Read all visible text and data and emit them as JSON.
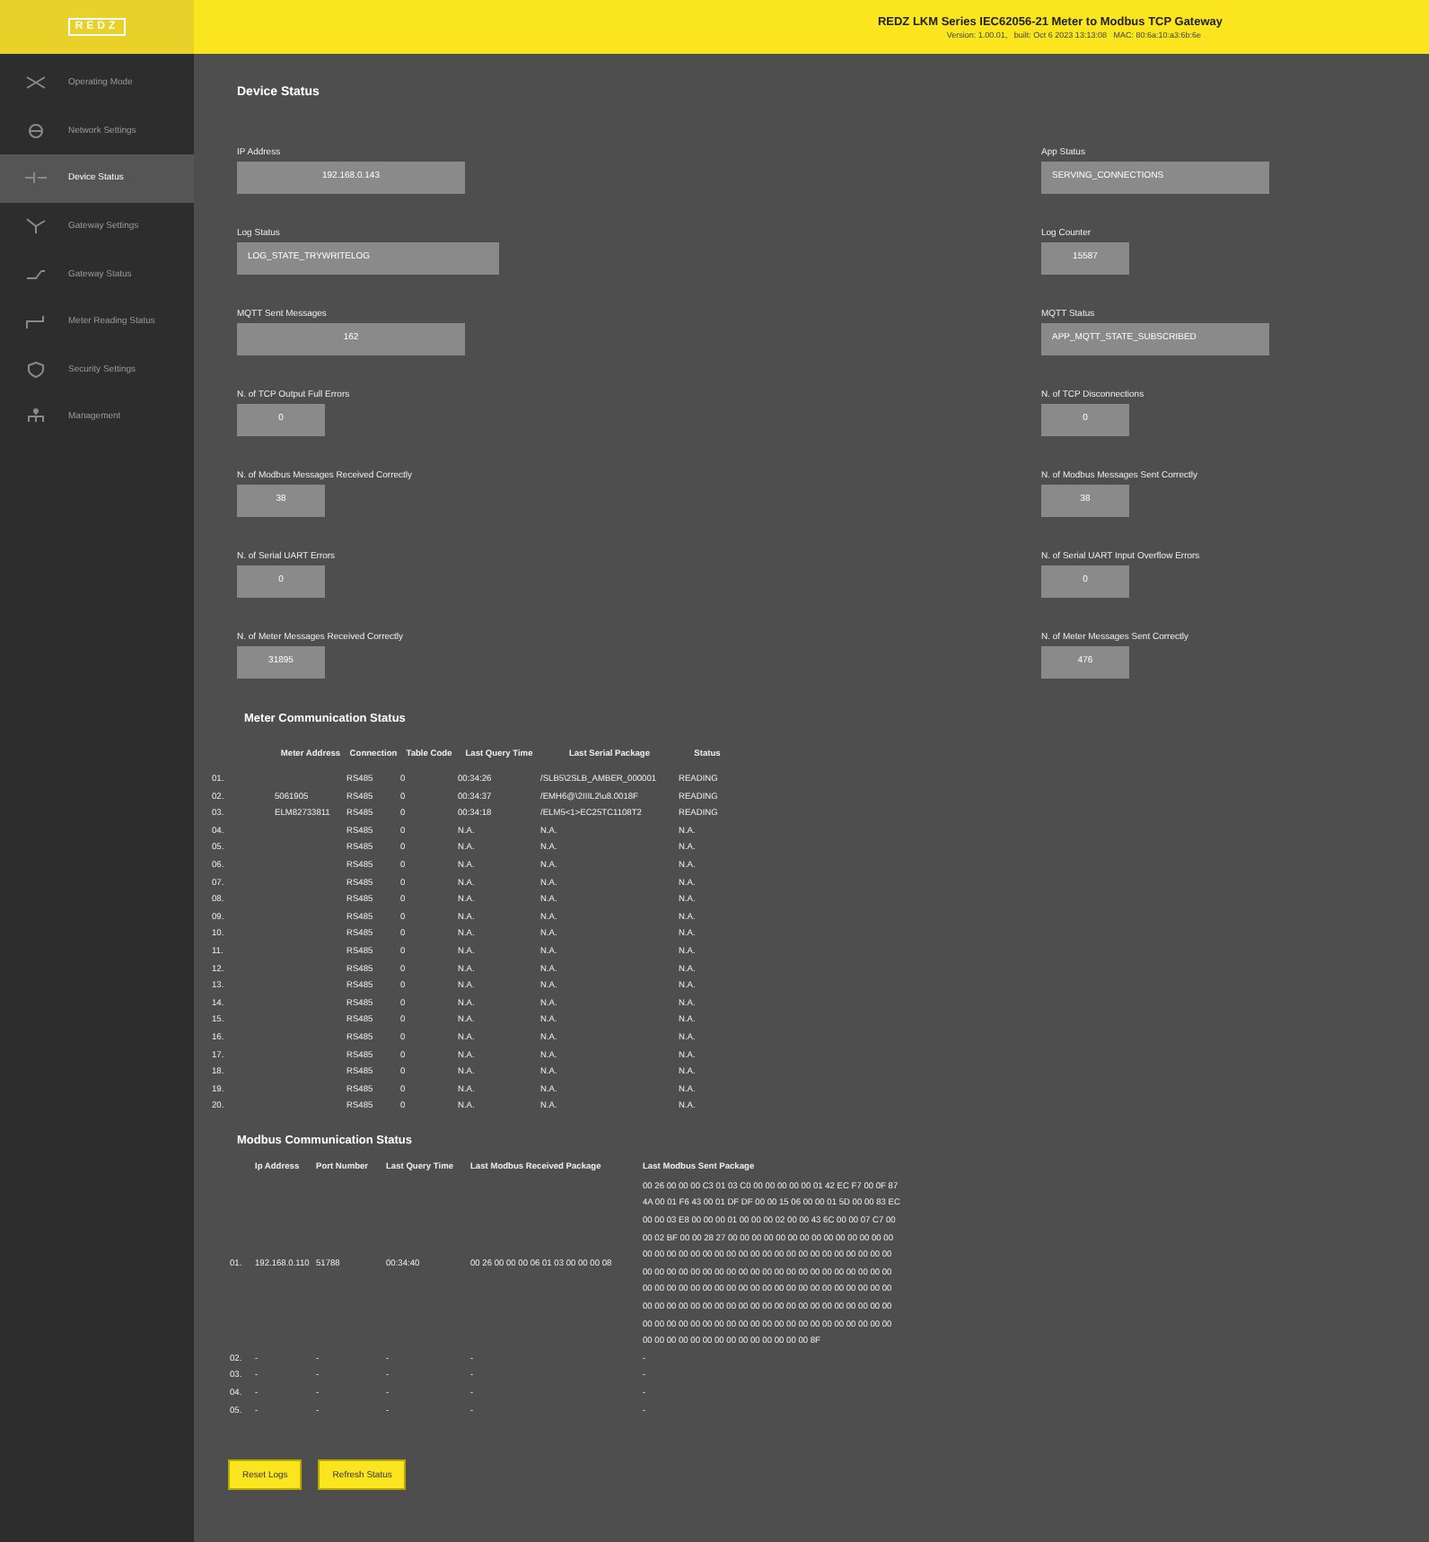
{
  "header": {
    "logo": "REDZ",
    "title": "REDZ LKM Series IEC62056-21 Meter to Modbus TCP Gateway",
    "subtitle": "Version: 1.00.01,   built: Oct 6 2023 13:13:08   MAC: 80:6a:10:a3:6b:6e"
  },
  "sidebar": {
    "items": [
      {
        "label": "Operating Mode",
        "selected": false
      },
      {
        "label": "Network Settings",
        "selected": false
      },
      {
        "label": "Device Status",
        "selected": true
      },
      {
        "label": "Gateway Settings",
        "selected": false
      },
      {
        "label": "Gateway Status",
        "selected": false
      },
      {
        "label": "Meter Reading Status",
        "selected": false
      },
      {
        "label": "Security Settings",
        "selected": false
      },
      {
        "label": "Management",
        "selected": false
      }
    ]
  },
  "device_status": {
    "title": "Device Status",
    "rows": [
      {
        "left": {
          "label": "IP Address",
          "value": "192.168.0.143"
        },
        "right": {
          "label": "App Status",
          "value": "SERVING_CONNECTIONS"
        }
      },
      {
        "left": {
          "label": "Log Status",
          "value": "LOG_STATE_TRYWRITELOG"
        },
        "right": {
          "label": "Log Counter",
          "value": "15587"
        }
      },
      {
        "left": {
          "label": "MQTT Sent Messages",
          "value": "162"
        },
        "right": {
          "label": "MQTT Status",
          "value": "APP_MQTT_STATE_SUBSCRIBED"
        }
      },
      {
        "left": {
          "label": "N. of TCP Output Full Errors",
          "value": "0"
        },
        "right": {
          "label": "N. of TCP Disconnections",
          "value": "0"
        }
      },
      {
        "left": {
          "label": "N. of Modbus Messages Received Correctly",
          "value": "38"
        },
        "right": {
          "label": "N. of Modbus Messages Sent Correctly",
          "value": "38"
        }
      },
      {
        "left": {
          "label": "N. of Serial UART Errors",
          "value": "0"
        },
        "right": {
          "label": "N. of Serial UART Input Overflow Errors",
          "value": "0"
        }
      },
      {
        "left": {
          "label": "N. of Meter Messages Received Correctly",
          "value": "31895"
        },
        "right": {
          "label": "N. of Meter Messages Sent Correctly",
          "value": "476"
        }
      }
    ]
  },
  "meter_communication": {
    "title": "Meter Communication Status",
    "columns": [
      "",
      "Meter Address",
      "Connection",
      "Table Code",
      "Last Query Time",
      "Last Serial Package",
      "Status"
    ],
    "rows": [
      [
        "01.",
        "",
        "RS485",
        "0",
        "00:34:26",
        "/SLB5\\2SLB_AMBER_000001",
        "READING"
      ],
      [
        "02.",
        "5061905",
        "RS485",
        "0",
        "00:34:37",
        "/EMH6@\\2IIIL2\\u8.0018F",
        "READING"
      ],
      [
        "03.",
        "ELM82733811",
        "RS485",
        "0",
        "00:34:18",
        "/ELM5<1>EC25TC1108T2",
        "READING"
      ],
      [
        "04.",
        "",
        "RS485",
        "0",
        "N.A.",
        "N.A.",
        "N.A."
      ],
      [
        "05.",
        "",
        "RS485",
        "0",
        "N.A.",
        "N.A.",
        "N.A."
      ],
      [
        "06.",
        "",
        "RS485",
        "0",
        "N.A.",
        "N.A.",
        "N.A."
      ],
      [
        "07.",
        "",
        "RS485",
        "0",
        "N.A.",
        "N.A.",
        "N.A."
      ],
      [
        "08.",
        "",
        "RS485",
        "0",
        "N.A.",
        "N.A.",
        "N.A."
      ],
      [
        "09.",
        "",
        "RS485",
        "0",
        "N.A.",
        "N.A.",
        "N.A."
      ],
      [
        "10.",
        "",
        "RS485",
        "0",
        "N.A.",
        "N.A.",
        "N.A."
      ],
      [
        "11.",
        "",
        "RS485",
        "0",
        "N.A.",
        "N.A.",
        "N.A."
      ],
      [
        "12.",
        "",
        "RS485",
        "0",
        "N.A.",
        "N.A.",
        "N.A."
      ],
      [
        "13.",
        "",
        "RS485",
        "0",
        "N.A.",
        "N.A.",
        "N.A."
      ],
      [
        "14.",
        "",
        "RS485",
        "0",
        "N.A.",
        "N.A.",
        "N.A."
      ],
      [
        "15.",
        "",
        "RS485",
        "0",
        "N.A.",
        "N.A.",
        "N.A."
      ],
      [
        "16.",
        "",
        "RS485",
        "0",
        "N.A.",
        "N.A.",
        "N.A."
      ],
      [
        "17.",
        "",
        "RS485",
        "0",
        "N.A.",
        "N.A.",
        "N.A."
      ],
      [
        "18.",
        "",
        "RS485",
        "0",
        "N.A.",
        "N.A.",
        "N.A."
      ],
      [
        "19.",
        "",
        "RS485",
        "0",
        "N.A.",
        "N.A.",
        "N.A."
      ],
      [
        "20.",
        "",
        "RS485",
        "0",
        "N.A.",
        "N.A.",
        "N.A."
      ]
    ]
  },
  "modbus_communication": {
    "title": "Modbus Communication Status",
    "columns": [
      "",
      "Ip Address",
      "Port Number",
      "Last Query Time",
      "Last Modbus Received Package",
      "Last Modbus Sent Package"
    ],
    "rows": [
      [
        "01.",
        "192.168.0.110",
        "51788",
        "00:34:40",
        "00 26 00 00 00 06 01 03 00 00 00 08",
        "00 26 00 00 00 C3 01 03 C0 00 00 00 00 00 01 42 EC F7 00 0F 87 4A 00 01 F6 43 00 01 DF DF 00 00 15 06 00 00 01 5D 00 00 83 EC 00 00 03 E8 00 00 00 01 00 00 00 02 00 00 43 6C 00 00 07 C7 00 00 02 BF 00 00 28 27 00 00 00 00 00 00 00 00 00 00 00 00 00 00 00 00 00 00 00 00 00 00 00 00 00 00 00 00 00 00 00 00 00 00 00 00 00 00 00 00 00 00 00 00 00 00 00 00 00 00 00 00 00 00 00 00 00 00 00 00 00 00 00 00 00 00 00 00 00 00 00 00 00 00 00 00 00 00 00 00 00 00 00 00 00 00 00 00 00 00 00 00 00 00 00 00 00 00 00 00 00 00 00 00 00 00 00 00 00 00 00 00 00 00 00 00 00 00 00 00 00 00 00 00 00 00 00 00 00 00 00 00 00 8F"
      ],
      [
        "02.",
        "-",
        "-",
        "-",
        "-",
        "-"
      ],
      [
        "03.",
        "-",
        "-",
        "-",
        "-",
        "-"
      ],
      [
        "04.",
        "-",
        "-",
        "-",
        "-",
        "-"
      ],
      [
        "05.",
        "-",
        "-",
        "-",
        "-",
        "-"
      ]
    ]
  },
  "buttons": [
    "Reset Logs",
    "Refresh Status"
  ]
}
